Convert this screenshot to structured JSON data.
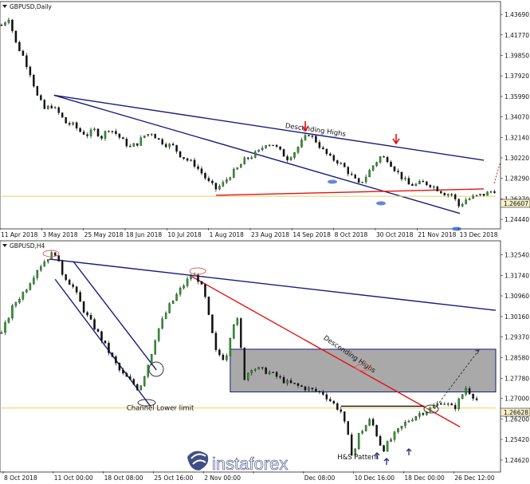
{
  "chart_data": [
    {
      "type": "candlestick",
      "symbol_label": "GBPUSD,Daily",
      "yticks": [
        "1.43690",
        "1.41770",
        "1.39850",
        "1.37920",
        "1.35990",
        "1.34070",
        "1.32140",
        "1.30220",
        "1.28290",
        "1.26370",
        "1.24440"
      ],
      "ylim": [
        1.237,
        1.446
      ],
      "current_price": "1.26607",
      "xticks": [
        "11 Apr 2018",
        "3 May 2018",
        "25 May 2018",
        "18 Jun 2018",
        "10 Jul 2018",
        "1 Aug 2018",
        "23 Aug 2018",
        "14 Sep 2018",
        "8 Oct 2018",
        "30 Oct 2018",
        "21 Nov 2018",
        "13 Dec 2018"
      ],
      "close_path": [
        [
          0,
          1.427
        ],
        [
          6,
          1.434
        ],
        [
          12,
          1.41
        ],
        [
          18,
          1.398
        ],
        [
          24,
          1.382
        ],
        [
          30,
          1.36
        ],
        [
          36,
          1.348
        ],
        [
          42,
          1.351
        ],
        [
          48,
          1.344
        ],
        [
          54,
          1.335
        ],
        [
          60,
          1.333
        ],
        [
          66,
          1.327
        ],
        [
          72,
          1.324
        ],
        [
          78,
          1.328
        ],
        [
          84,
          1.322
        ],
        [
          90,
          1.33
        ],
        [
          96,
          1.325
        ],
        [
          102,
          1.318
        ],
        [
          108,
          1.312
        ],
        [
          114,
          1.316
        ],
        [
          120,
          1.323
        ],
        [
          126,
          1.326
        ],
        [
          132,
          1.319
        ],
        [
          138,
          1.315
        ],
        [
          144,
          1.313
        ],
        [
          150,
          1.305
        ],
        [
          156,
          1.3
        ],
        [
          162,
          1.296
        ],
        [
          168,
          1.288
        ],
        [
          174,
          1.279
        ],
        [
          180,
          1.273
        ],
        [
          186,
          1.278
        ],
        [
          192,
          1.286
        ],
        [
          198,
          1.292
        ],
        [
          204,
          1.3
        ],
        [
          210,
          1.304
        ],
        [
          216,
          1.308
        ],
        [
          222,
          1.316
        ],
        [
          228,
          1.315
        ],
        [
          234,
          1.308
        ],
        [
          240,
          1.302
        ],
        [
          246,
          1.308
        ],
        [
          252,
          1.317
        ],
        [
          258,
          1.325
        ],
        [
          264,
          1.318
        ],
        [
          270,
          1.309
        ],
        [
          276,
          1.302
        ],
        [
          282,
          1.299
        ],
        [
          288,
          1.293
        ],
        [
          294,
          1.285
        ],
        [
          300,
          1.277
        ],
        [
          306,
          1.285
        ],
        [
          312,
          1.295
        ],
        [
          318,
          1.303
        ],
        [
          324,
          1.301
        ],
        [
          330,
          1.292
        ],
        [
          336,
          1.284
        ],
        [
          342,
          1.277
        ],
        [
          348,
          1.277
        ],
        [
          354,
          1.279
        ],
        [
          360,
          1.277
        ],
        [
          366,
          1.273
        ],
        [
          372,
          1.269
        ],
        [
          378,
          1.268
        ],
        [
          384,
          1.257
        ],
        [
          390,
          1.263
        ],
        [
          396,
          1.265
        ],
        [
          402,
          1.267
        ],
        [
          408,
          1.269
        ],
        [
          414,
          1.272
        ]
      ],
      "lines": [
        {
          "name": "upper-trendline",
          "color": "#1a1a80",
          "points": [
            [
              44,
              1.361
            ],
            [
              405,
              1.3
            ]
          ]
        },
        {
          "name": "lower-trendline",
          "color": "#1a1a80",
          "points": [
            [
              44,
              1.361
            ],
            [
              385,
              1.25
            ]
          ]
        },
        {
          "name": "support",
          "color": "#e81010",
          "points": [
            [
              180,
              1.267
            ],
            [
              405,
              1.273
            ]
          ]
        },
        {
          "name": "current-level",
          "color": "#e8d060",
          "points": [
            [
              0,
              1.2661
            ],
            [
              415,
              1.2661
            ]
          ]
        }
      ],
      "annotations": [
        {
          "text": "Descending Highs",
          "at": [
            238,
            1.3305
          ]
        }
      ]
    },
    {
      "type": "candlestick",
      "symbol_label": "GBPUSD,H4",
      "yticks": [
        "1.32540",
        "1.31740",
        "1.30960",
        "1.30160",
        "1.29370",
        "1.28580",
        "1.27780",
        "1.27000",
        "1.26200",
        "1.25420",
        "1.24620"
      ],
      "ylim": [
        1.2422,
        1.329
      ],
      "current_price": "1.26628",
      "xticks": [
        "8 Oct 2018",
        "11 Oct 00:00",
        "18 Oct 08:00",
        "25 Oct 16:00",
        "2 Nov 00:00",
        "",
        "Dec 08:00",
        "10 Dec 16:00",
        "18 Dec 00:00",
        "26 Dec 12:00"
      ],
      "close_path": [
        [
          0,
          1.295
        ],
        [
          10,
          1.306
        ],
        [
          20,
          1.312
        ],
        [
          30,
          1.32
        ],
        [
          40,
          1.325
        ],
        [
          45,
          1.3262
        ],
        [
          50,
          1.319
        ],
        [
          60,
          1.313
        ],
        [
          70,
          1.303
        ],
        [
          80,
          1.296
        ],
        [
          90,
          1.288
        ],
        [
          100,
          1.28
        ],
        [
          110,
          1.276
        ],
        [
          115,
          1.2735
        ],
        [
          118,
          1.2765
        ],
        [
          125,
          1.286
        ],
        [
          130,
          1.295
        ],
        [
          140,
          1.305
        ],
        [
          150,
          1.312
        ],
        [
          160,
          1.318
        ],
        [
          165,
          1.316
        ],
        [
          170,
          1.311
        ],
        [
          175,
          1.299
        ],
        [
          180,
          1.288
        ],
        [
          188,
          1.285
        ],
        [
          194,
          1.299
        ],
        [
          198,
          1.3
        ],
        [
          204,
          1.278
        ],
        [
          210,
          1.282
        ],
        [
          225,
          1.28
        ],
        [
          240,
          1.276
        ],
        [
          255,
          1.274
        ],
        [
          270,
          1.272
        ],
        [
          285,
          1.265
        ],
        [
          290,
          1.257
        ],
        [
          295,
          1.247
        ],
        [
          300,
          1.256
        ],
        [
          310,
          1.262
        ],
        [
          320,
          1.25
        ],
        [
          330,
          1.256
        ],
        [
          340,
          1.261
        ],
        [
          350,
          1.264
        ],
        [
          360,
          1.266
        ],
        [
          370,
          1.269
        ],
        [
          380,
          1.266
        ],
        [
          390,
          1.274
        ],
        [
          400,
          1.269
        ]
      ],
      "lines": [
        {
          "name": "long-trendline",
          "color": "#1a1a80",
          "points": [
            [
              40,
              1.3238
            ],
            [
              415,
              1.304
            ]
          ]
        },
        {
          "name": "channel-top",
          "color": "#1a1a80",
          "points": [
            [
              60,
              1.323
            ],
            [
              130,
              1.281
            ]
          ]
        },
        {
          "name": "channel-bottom",
          "color": "#1a1a80",
          "points": [
            [
              45,
              1.316
            ],
            [
              125,
              1.267
            ]
          ]
        },
        {
          "name": "descending-highs",
          "color": "#e81010",
          "points": [
            [
              160,
              1.317
            ],
            [
              385,
              1.259
            ]
          ]
        },
        {
          "name": "neckline",
          "color": "#111111",
          "points": [
            [
              285,
              1.267
            ],
            [
              355,
              1.267
            ]
          ]
        },
        {
          "name": "current-level",
          "color": "#e8d060",
          "points": [
            [
              0,
              1.2663
            ],
            [
              415,
              1.2663
            ]
          ]
        }
      ],
      "zones": [
        {
          "name": "consolidation-box",
          "x": [
            192,
            415
          ],
          "y": [
            1.2725,
            1.289
          ]
        }
      ],
      "annotations": [
        {
          "text": "Descending Highs",
          "at": [
            270,
            1.293
          ]
        },
        {
          "text": "Channel Lower limit",
          "at": [
            105,
            1.2655
          ]
        },
        {
          "text": "H&S Pattern",
          "at": [
            282,
            1.2465
          ]
        }
      ]
    }
  ],
  "watermark": "instaforex"
}
